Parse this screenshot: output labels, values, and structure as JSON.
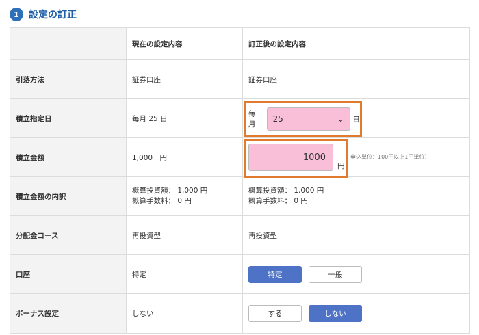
{
  "section": {
    "step": "1",
    "title": "設定の訂正"
  },
  "table": {
    "col_current": "現在の設定内容",
    "col_new": "訂正後の設定内容",
    "rows": {
      "method": {
        "label": "引落方法",
        "current": "証券口座",
        "new": "証券口座"
      },
      "day": {
        "label": "積立指定日",
        "current": "毎月 25 日",
        "prefix": "毎月",
        "value": "25",
        "suffix": "日"
      },
      "amount": {
        "label": "積立金額",
        "current": "1,000　円",
        "value": "1000",
        "unit": "円",
        "note": "申込単位：100円以上1円単位）"
      },
      "breakdown": {
        "label": "積立金額の内訳",
        "current_1": "概算投資額： 1,000 円",
        "current_2": "概算手数料： 0 円",
        "new_1": "概算投資額： 1,000 円",
        "new_2": "概算手数料： 0 円"
      },
      "course": {
        "label": "分配金コース",
        "current": "再投資型",
        "new": "再投資型"
      },
      "account": {
        "label": "口座",
        "current": "特定",
        "option_a": "特定",
        "option_b": "一般",
        "selected": "特定"
      },
      "bonus": {
        "label": "ボーナス設定",
        "current": "しない",
        "option_a": "する",
        "option_b": "しない",
        "selected": "しない"
      }
    }
  },
  "colors": {
    "accent": "#2d6fb8",
    "highlight_border": "#e07a2f",
    "input_bg": "#f9bfd9",
    "button_on": "#4d72c6"
  }
}
